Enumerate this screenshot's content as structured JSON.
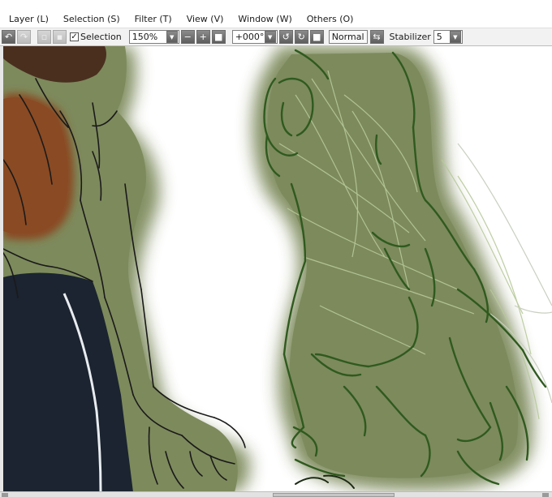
{
  "menu": [
    "Layer (L)",
    "Selection (S)",
    "Filter (T)",
    "View (V)",
    "Window (W)",
    "Others (O)"
  ],
  "toolbar": {
    "undo_icon": "undo-icon",
    "redo_icon": "redo-icon",
    "selection_label": "Selection",
    "selection_checked": true,
    "zoom": "150%",
    "rotation": "+000°",
    "blend_mode": "Normal",
    "stabilizer_label": "Stabilizer",
    "stabilizer_value": "5"
  },
  "colors": {
    "skin": "#7d8a5c",
    "skin_shadow": "#5f6b48",
    "sketch": "#2f5a1f",
    "sketch_light": "#b7c99a",
    "vest": "#8a4a23",
    "hair": "#4a2f1f",
    "pants": "#1b2430"
  }
}
